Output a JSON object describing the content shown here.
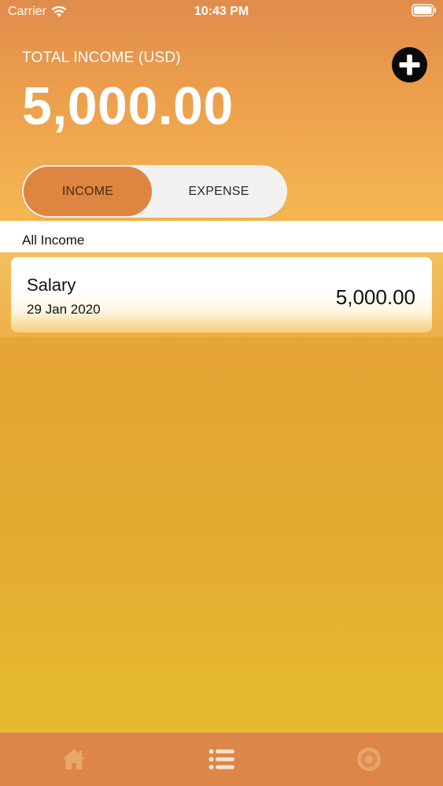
{
  "status_bar": {
    "carrier": "Carrier",
    "time": "10:43 PM"
  },
  "header": {
    "total_label": "TOTAL INCOME (USD)",
    "total_amount": "5,000.00",
    "add_icon": "plus-circle-icon"
  },
  "segmented": {
    "selected": "income",
    "income_label": "INCOME",
    "expense_label": "EXPENSE"
  },
  "section": {
    "title": "All Income"
  },
  "items": [
    {
      "name": "Salary",
      "date": "29 Jan 2020",
      "amount": "5,000.00"
    }
  ],
  "tab_bar": {
    "tabs": [
      {
        "icon": "home-icon"
      },
      {
        "icon": "list-icon",
        "selected": true
      },
      {
        "icon": "gear-icon"
      }
    ]
  },
  "colors": {
    "accent": "#dd8541",
    "tab_bar": "#dc8647",
    "tab_icon_inactive": "#e7a66a",
    "tab_icon_active": "#f6e3d3"
  }
}
